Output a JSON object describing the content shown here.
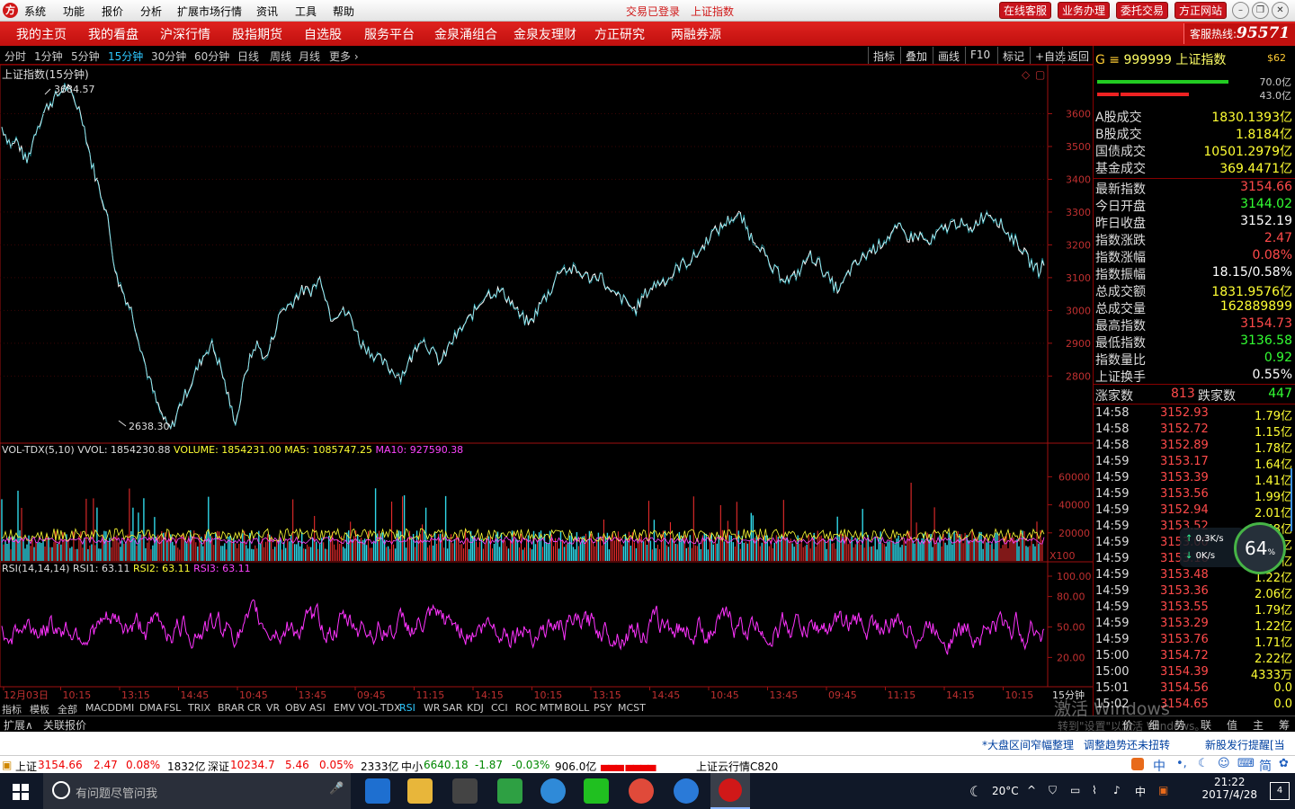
{
  "menubar": {
    "logo": "方",
    "items": [
      "系统",
      "功能",
      "报价",
      "分析",
      "扩展市场行情",
      "资讯",
      "工具",
      "帮助"
    ],
    "status": [
      "交易已登录",
      "上证指数"
    ],
    "buttons": [
      "在线客服",
      "业务办理",
      "委托交易",
      "方正网站"
    ]
  },
  "navbar": {
    "items": [
      "我的主页",
      "我的看盘",
      "沪深行情",
      "股指期货",
      "自选股",
      "服务平台",
      "金泉涌组合",
      "金泉友理财",
      "方正研究",
      "两融券源"
    ],
    "hotline_label": "客服热线:",
    "hotline_number": "95571"
  },
  "periods": {
    "items": [
      "分时",
      "1分钟",
      "5分钟",
      "15分钟",
      "30分钟",
      "60分钟",
      "日线",
      "周线",
      "月线",
      "更多 ›"
    ],
    "active": "15分钟"
  },
  "toolbar_right": [
    "指标",
    "叠加",
    "画线",
    "F10",
    "标记",
    "+自选",
    "返回"
  ],
  "chart_data": {
    "type": "line",
    "title": "上证指数(15分钟)",
    "ylim": [
      2620,
      3700
    ],
    "yticks": [
      2800,
      2900,
      3000,
      3100,
      3200,
      3300,
      3400,
      3500,
      3600
    ],
    "x_labels": [
      "12月03日",
      "10:15",
      "13:15",
      "14:45",
      "10:45",
      "13:45",
      "09:45",
      "11:15",
      "14:15",
      "10:15",
      "13:15",
      "14:45",
      "10:45",
      "13:45",
      "09:45",
      "11:15",
      "14:15",
      "10:15"
    ],
    "period_label": "15分钟",
    "high_label": "3684.57",
    "low_label": "2638.30",
    "price_anchors": [
      [
        0,
        3560
      ],
      [
        2,
        3500
      ],
      [
        3,
        3520
      ],
      [
        5,
        3450
      ],
      [
        7,
        3560
      ],
      [
        9,
        3620
      ],
      [
        12,
        3670
      ],
      [
        13,
        3684.57
      ],
      [
        16,
        3600
      ],
      [
        18,
        3450
      ],
      [
        21,
        3300
      ],
      [
        23,
        3100
      ],
      [
        26,
        3000
      ],
      [
        29,
        2820
      ],
      [
        31,
        2720
      ],
      [
        33,
        2650
      ],
      [
        34,
        2638.3
      ],
      [
        36,
        2720
      ],
      [
        38,
        2780
      ],
      [
        40,
        2850
      ],
      [
        42,
        2900
      ],
      [
        44,
        2820
      ],
      [
        46,
        2700
      ],
      [
        47,
        2660
      ],
      [
        49,
        2820
      ],
      [
        51,
        2900
      ],
      [
        53,
        2850
      ],
      [
        56,
        3000
      ],
      [
        58,
        3020
      ],
      [
        60,
        3060
      ],
      [
        62,
        3060
      ],
      [
        64,
        3100
      ],
      [
        66,
        2980
      ],
      [
        68,
        3000
      ],
      [
        70,
        2980
      ],
      [
        72,
        2900
      ],
      [
        75,
        2860
      ],
      [
        78,
        2820
      ],
      [
        80,
        2800
      ],
      [
        82,
        2850
      ],
      [
        84,
        2920
      ],
      [
        86,
        2880
      ],
      [
        88,
        2840
      ],
      [
        90,
        2900
      ],
      [
        92,
        2940
      ],
      [
        95,
        3000
      ],
      [
        97,
        3050
      ],
      [
        100,
        3060
      ],
      [
        102,
        3030
      ],
      [
        104,
        2980
      ],
      [
        106,
        2960
      ],
      [
        108,
        3020
      ],
      [
        110,
        3060
      ],
      [
        112,
        3130
      ],
      [
        115,
        3120
      ],
      [
        118,
        3100
      ],
      [
        120,
        3110
      ],
      [
        122,
        3050
      ],
      [
        124,
        3040
      ],
      [
        127,
        3000
      ],
      [
        129,
        3050
      ],
      [
        131,
        3080
      ],
      [
        134,
        3100
      ],
      [
        136,
        3140
      ],
      [
        138,
        3150
      ],
      [
        140,
        3180
      ],
      [
        142,
        3230
      ],
      [
        144,
        3250
      ],
      [
        146,
        3280
      ],
      [
        148,
        3290
      ],
      [
        150,
        3230
      ],
      [
        152,
        3200
      ],
      [
        154,
        3130
      ],
      [
        156,
        3110
      ],
      [
        158,
        3090
      ],
      [
        160,
        3120
      ],
      [
        162,
        3170
      ],
      [
        164,
        3140
      ],
      [
        166,
        3090
      ],
      [
        168,
        3060
      ],
      [
        170,
        3120
      ],
      [
        172,
        3150
      ],
      [
        174,
        3180
      ],
      [
        176,
        3200
      ],
      [
        178,
        3230
      ],
      [
        180,
        3250
      ],
      [
        182,
        3220
      ],
      [
        184,
        3230
      ],
      [
        186,
        3200
      ],
      [
        188,
        3240
      ],
      [
        190,
        3260
      ],
      [
        192,
        3270
      ],
      [
        194,
        3240
      ],
      [
        196,
        3280
      ],
      [
        198,
        3300
      ],
      [
        200,
        3270
      ],
      [
        202,
        3230
      ],
      [
        204,
        3200
      ],
      [
        206,
        3150
      ],
      [
        208,
        3120
      ],
      [
        209,
        3154.66
      ]
    ],
    "volume": {
      "label": "VOL-TDX(5,10)",
      "vvol": "VVOL: 1854230.88",
      "volume": "VOLUME: 1854231.00",
      "ma5": "MA5: 1085747.25",
      "ma10": "MA10: 927590.38",
      "yticks": [
        20000,
        40000,
        60000
      ],
      "unit": "X100"
    },
    "rsi": {
      "label": "RSI(14,14,14)",
      "rsi1": "RSI1: 63.11",
      "rsi2": "RSI2: 63.11",
      "rsi3": "RSI3: 63.11",
      "yticks": [
        "100.00",
        "80.00",
        "50.00",
        "20.00"
      ]
    }
  },
  "right_panel": {
    "code": "999999",
    "name": "上证指数",
    "badge": "$62",
    "bar1": "70.0亿",
    "bar2": "43.0亿",
    "rows": [
      [
        "A股成交",
        "1830.1393亿",
        "#ffff33"
      ],
      [
        "B股成交",
        "1.8184亿",
        "#ffff33"
      ],
      [
        "国债成交",
        "10501.2979亿",
        "#ffff33"
      ],
      [
        "基金成交",
        "369.4471亿",
        "#ffff33"
      ],
      [
        "最新指数",
        "3154.66",
        "#ff4a4a"
      ],
      [
        "今日开盘",
        "3144.02",
        "#33ff33"
      ],
      [
        "昨日收盘",
        "3152.19",
        "#ffffff"
      ],
      [
        "指数涨跌",
        "2.47",
        "#ff4a4a"
      ],
      [
        "指数涨幅",
        "0.08%",
        "#ff4a4a"
      ],
      [
        "指数振幅",
        "18.15/0.58%",
        "#ffffff"
      ],
      [
        "总成交额",
        "1831.9576亿",
        "#ffff33"
      ],
      [
        "总成交量",
        "162889899",
        "#ffff33"
      ],
      [
        "最高指数",
        "3154.73",
        "#ff4a4a"
      ],
      [
        "最低指数",
        "3136.58",
        "#33ff33"
      ],
      [
        "指数量比",
        "0.92",
        "#33ff33"
      ],
      [
        "上证换手",
        "0.55%",
        "#ffffff"
      ]
    ],
    "up_label": "涨家数",
    "up_count": "813",
    "down_label": "跌家数",
    "down_count": "447",
    "ticks": [
      [
        "14:58",
        "3152.93",
        "1.79亿"
      ],
      [
        "14:58",
        "3152.72",
        "1.15亿"
      ],
      [
        "14:58",
        "3152.89",
        "1.78亿"
      ],
      [
        "14:59",
        "3153.17",
        "1.64亿"
      ],
      [
        "14:59",
        "3153.39",
        "1.41亿"
      ],
      [
        "14:59",
        "3153.56",
        "1.99亿"
      ],
      [
        "14:59",
        "3152.94",
        "2.01亿"
      ],
      [
        "14:59",
        "3153.52",
        "1.58亿"
      ],
      [
        "14:59",
        "3153.00",
        "2.83亿"
      ],
      [
        "14:59",
        "3153.16",
        "2.16亿"
      ],
      [
        "14:59",
        "3153.48",
        "1.22亿"
      ],
      [
        "14:59",
        "3153.36",
        "2.06亿"
      ],
      [
        "14:59",
        "3153.55",
        "1.79亿"
      ],
      [
        "14:59",
        "3153.29",
        "1.22亿"
      ],
      [
        "14:59",
        "3153.76",
        "1.71亿"
      ],
      [
        "15:00",
        "3154.72",
        "2.22亿"
      ],
      [
        "15:00",
        "3154.39",
        "4333万"
      ],
      [
        "15:01",
        "3154.56",
        "0.0"
      ],
      [
        "15:02",
        "3154.65",
        "0.0"
      ]
    ],
    "net_up": "0.3K/s",
    "net_down": "0K/s",
    "net_pct": "64"
  },
  "tabs1": [
    "指标",
    "模板",
    "全部",
    "MACD",
    "DMI",
    "DMA",
    "FSL",
    "TRIX",
    "BRAR",
    "CR",
    "VR",
    "OBV",
    "ASI",
    "EMV",
    "VOL-TDX",
    "RSI",
    "WR",
    "SAR",
    "KDJ",
    "CCI",
    "ROC",
    "MTM",
    "BOLL",
    "PSY",
    "MCST"
  ],
  "tabs1_active": "RSI",
  "tabs2": [
    "扩展∧",
    "关联报价"
  ],
  "tabs2_right": [
    "价",
    "细",
    "势",
    "联",
    "值",
    "主",
    "筹"
  ],
  "watermark": [
    "激活 Windows",
    "转到\"设置\"以激活 Windows。"
  ],
  "news": [
    "*大盘区间窄幅整理",
    "调整趋势还未扭转",
    "新股发行提醒[当日"
  ],
  "ticker": {
    "sh_label": "上证",
    "sh_val": "3154.66",
    "sh_chg": "2.47",
    "sh_pct": "0.08%",
    "sh_amt": "1832亿",
    "sz_label": "深证",
    "sz_val": "10234.7",
    "sz_chg": "5.46",
    "sz_pct": "0.05%",
    "sz_amt": "2333亿",
    "zx_label": "中小",
    "zx_val": "6640.18",
    "zx_chg": "-1.87",
    "zx_pct": "-0.03%",
    "zx_amt": "906.0亿",
    "cloud": "上证云行情C820"
  },
  "ime": [
    "中",
    "简"
  ],
  "taskbar": {
    "search": "有问题尽管问我",
    "temp": "20°C",
    "lang": "中",
    "time": "21:22",
    "date": "2017/4/28",
    "notif": "4"
  }
}
